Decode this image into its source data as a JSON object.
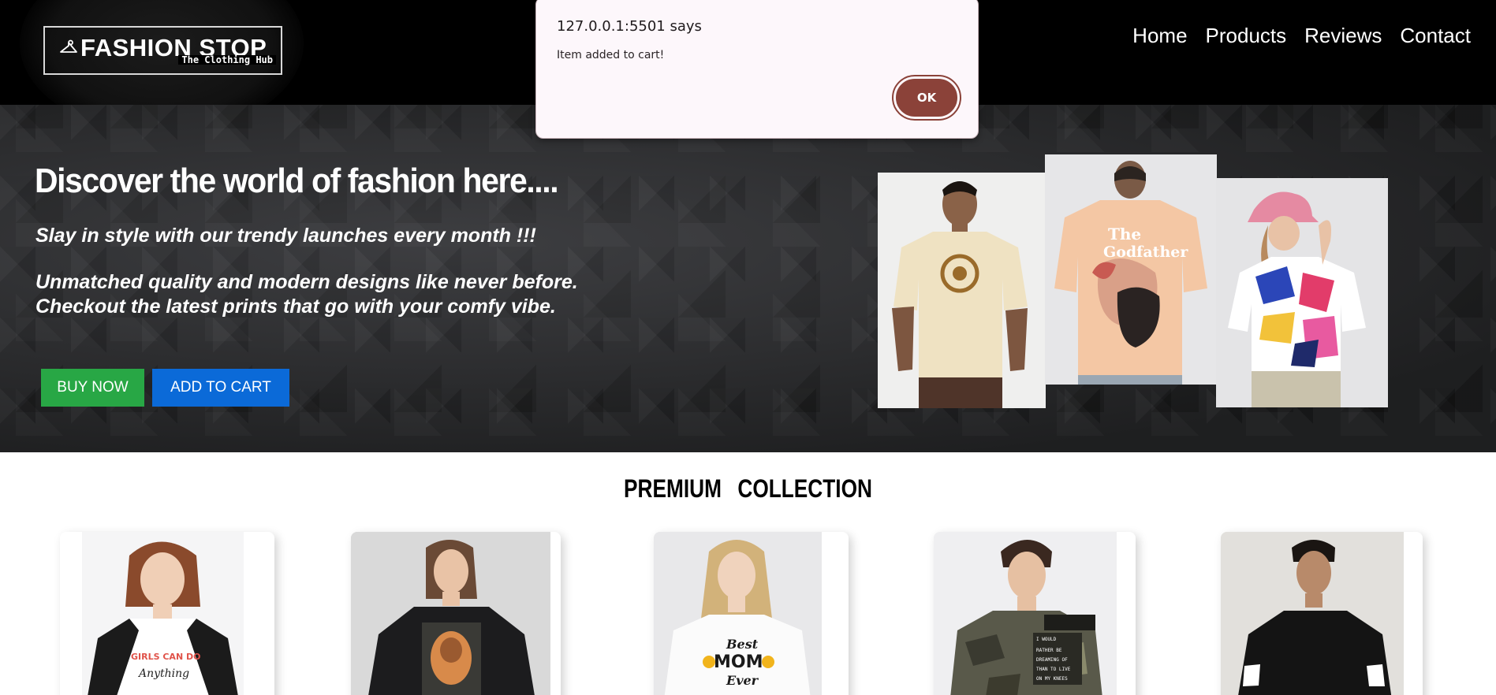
{
  "dialog": {
    "title": "127.0.0.1:5501 says",
    "message": "Item added to cart!",
    "ok_label": "OK"
  },
  "logo": {
    "title": "FASHION STOP",
    "subtitle": "The Clothing Hub",
    "icon": "hanger-icon"
  },
  "nav": {
    "items": [
      "Home",
      "Products",
      "Reviews",
      "Contact"
    ]
  },
  "hero": {
    "title": "Discover the world of fashion here....",
    "tagline": "Slay in style with our trendy launches every month !!!",
    "description": "Unmatched quality and modern designs like never before. Checkout the latest prints that go with your comfy vibe.",
    "buy_label": "BUY NOW",
    "cart_label": "ADD TO CART",
    "colors": {
      "buy": "#28a745",
      "cart": "#0b6ad8"
    }
  },
  "collection": {
    "title": "PREMIUM   COLLECTION",
    "products": [
      {
        "print": [
          "GIRLS CAN DO",
          "Anything"
        ]
      },
      {
        "print": []
      },
      {
        "print": [
          "Best",
          "MOM",
          "Ever"
        ]
      },
      {
        "print": [
          "I WOULD",
          "RATHER BE",
          "DREAMING OF",
          "THAN TO LIVE",
          "ON MY KNEES"
        ]
      },
      {
        "print": []
      }
    ]
  },
  "hero_print": {
    "top": "The",
    "main": "Godfather"
  }
}
